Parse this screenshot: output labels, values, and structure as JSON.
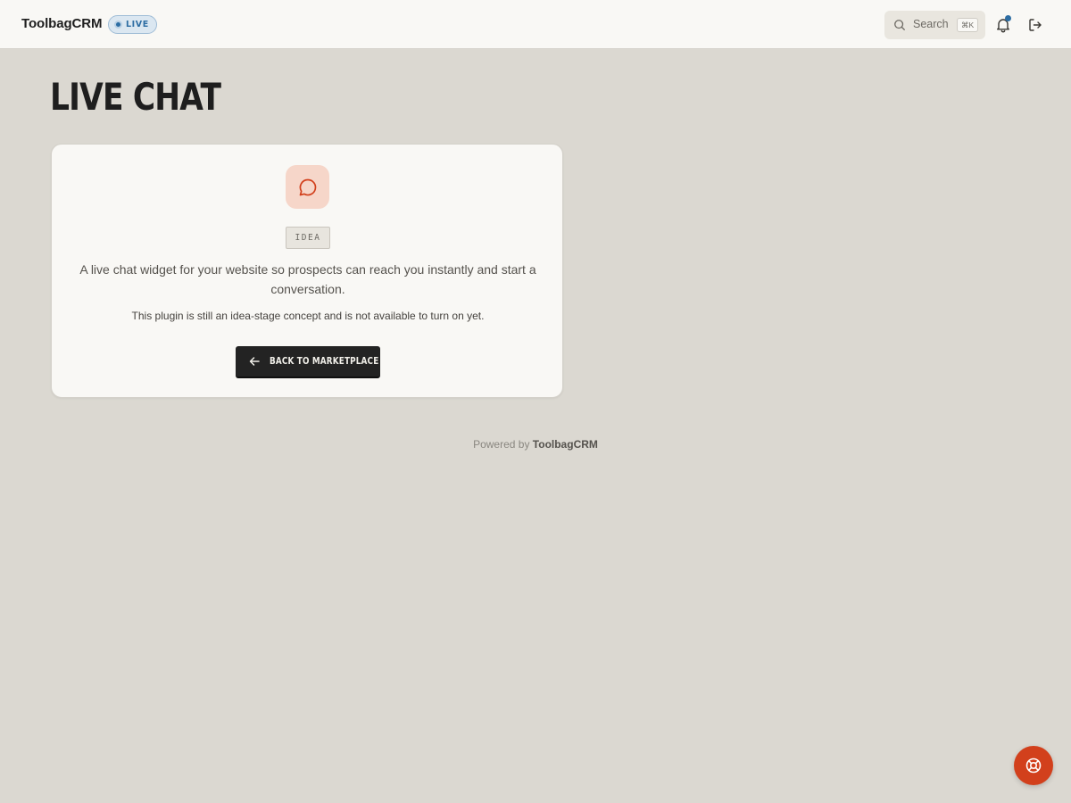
{
  "header": {
    "brand": "ToolbagCRM",
    "status_badge": "LIVE",
    "search": {
      "label": "Search",
      "shortcut": "⌘K"
    },
    "icons": [
      "search-icon",
      "bell-icon",
      "logout-icon"
    ],
    "notification_dot_color": "#2d6da3"
  },
  "main": {
    "title": "LIVE CHAT",
    "card": {
      "icon": "chat-bubble-icon",
      "stage_badge": "IDEA",
      "description": "A live chat widget for your website so prospects can reach you instantly and start a conversation.",
      "note": "This plugin is still an idea-stage concept and is not available to turn on yet.",
      "back_button_label": "BACK TO MARKETPLACE"
    }
  },
  "footer": {
    "powered_prefix": "Powered by",
    "powered_brand": "ToolbagCRM"
  },
  "help_button": {
    "icon": "lifebuoy-icon",
    "color": "#d2401c"
  },
  "colors": {
    "accent": "#d2401c",
    "live_blue": "#2d6da3",
    "background": "#dbd8d1",
    "surface": "#f9f8f5"
  }
}
